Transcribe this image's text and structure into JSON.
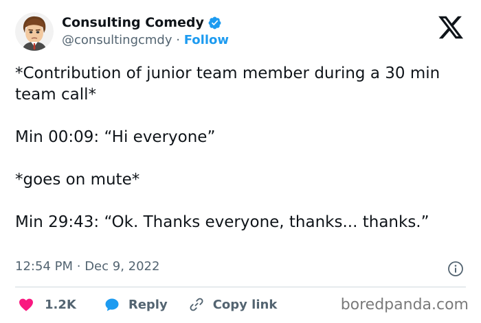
{
  "author": {
    "display_name": "Consulting Comedy",
    "handle": "@consultingcmdy",
    "separator": "·",
    "follow_label": "Follow",
    "verified_icon": "verified-badge-icon",
    "avatar_icon": "cartoon-avatar"
  },
  "tweet": {
    "paragraphs": [
      "*Contribution of junior team member during a 30 min team call*",
      "Min 00:09: “Hi everyone”",
      "*goes on mute*",
      "Min 29:43: “Ok. Thanks everyone, thanks... thanks.”"
    ],
    "time": "12:54 PM",
    "separator": "·",
    "date": "Dec 9, 2022"
  },
  "actions": {
    "like_count": "1.2K",
    "reply_label": "Reply",
    "copy_link_label": "Copy link"
  },
  "watermark": "boredpanda.com",
  "colors": {
    "accent": "#1d9bf0",
    "like": "#f91880",
    "text": "#0f1419",
    "muted": "#536471",
    "divider": "#cfd9de"
  },
  "icons": [
    "x-logo-icon",
    "info-icon",
    "heart-icon",
    "reply-bubble-icon",
    "link-icon"
  ]
}
